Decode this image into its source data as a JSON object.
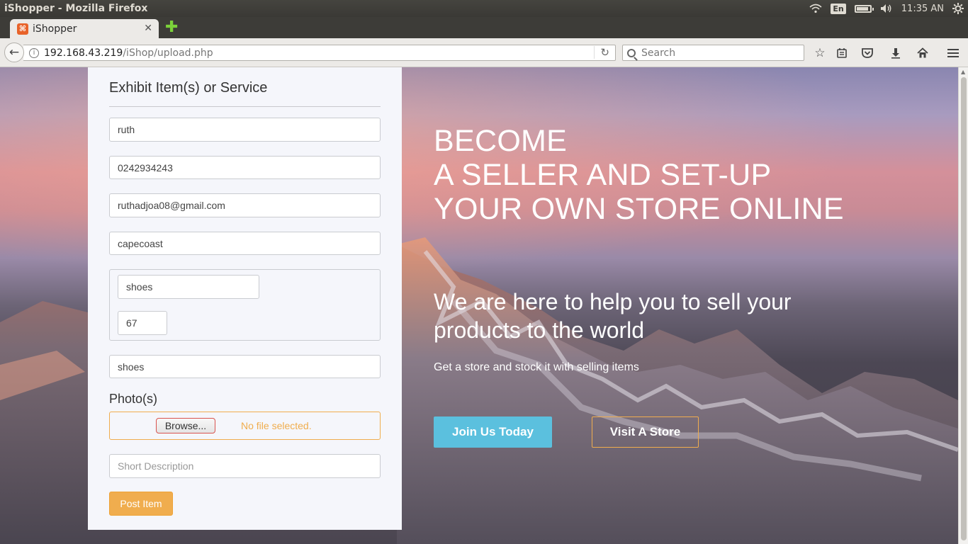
{
  "window": {
    "title": "iShopper - Mozilla Firefox"
  },
  "system_tray": {
    "language": "En",
    "time": "11:35 AN"
  },
  "browser": {
    "tab": {
      "title": "iShopper",
      "favicon_text": "⌘"
    },
    "url": {
      "host": "192.168.43.219",
      "path": "/iShop/upload.php"
    },
    "search": {
      "placeholder": "Search"
    }
  },
  "form": {
    "heading": "Exhibit Item(s) or Service",
    "name": "ruth",
    "phone": "0242934243",
    "email": "ruthadjoa08@gmail.com",
    "location": "capecoast",
    "item_name": "shoes",
    "item_price": "67",
    "category": "shoes",
    "photo_label": "Photo(s)",
    "browse_label": "Browse...",
    "file_status": "No file selected.",
    "description_placeholder": "Short Description",
    "submit_label": "Post Item"
  },
  "hero": {
    "title_line1": "BECOME",
    "title_line2": "A SELLER AND SET-UP",
    "title_line3": "YOUR OWN STORE ONLINE",
    "subtitle": "We are here to help you to sell your products to the world",
    "tagline": "Get a store and stock it with selling items",
    "join_button": "Join Us Today",
    "visit_button": "Visit A Store"
  },
  "colors": {
    "primary_info": "#5bc0de",
    "warning": "#f0ad4e",
    "panel_bg": "#f5f6fb"
  }
}
